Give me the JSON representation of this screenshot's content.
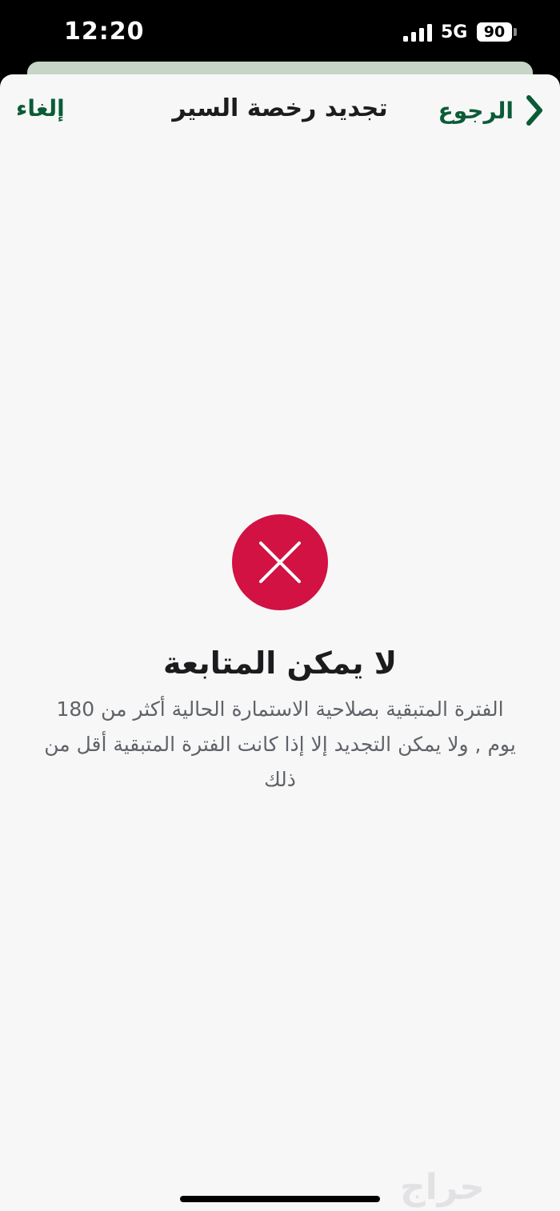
{
  "status_bar": {
    "time": "12:20",
    "network": "5G",
    "battery": "90"
  },
  "nav": {
    "back_label": "الرجوع",
    "title": "تجديد رخصة السير",
    "cancel_label": "إلغاء"
  },
  "error": {
    "title": "لا يمكن المتابعة",
    "message": "الفترة المتبقية بصلاحية الاستمارة الحالية أكثر من 180 يوم , ولا يمكن التجديد إلا إذا كانت الفترة المتبقية أقل من ذلك"
  },
  "watermark": "حراج",
  "colors": {
    "accent_green": "#0a5c36",
    "error_red": "#d11242"
  },
  "icons": {
    "back": "chevron-right-icon",
    "error": "close-icon"
  }
}
